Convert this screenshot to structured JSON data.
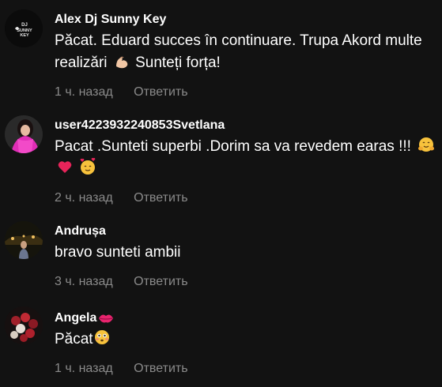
{
  "comments": [
    {
      "author": "Alex Dj Sunny Key",
      "avatar_text": "DJ SUNNY KEY",
      "text_before": "Păcat. Eduard succes în continuare. Trupa Akord multe realizări",
      "text_after": " Sunteți forța!",
      "emojis": [
        "flexed-biceps-emoji"
      ],
      "time": "1 ч. назад",
      "reply_label": "Ответить"
    },
    {
      "author": "user4223932240853Svetlana",
      "text_before": "Pacat .Sunteti superbi .Dorim sa va revedem earas !!!",
      "emojis": [
        "hugging-face-emoji",
        "heart-emoji",
        "smiling-face-hearts-emoji"
      ],
      "time": "2 ч. назад",
      "reply_label": "Ответить"
    },
    {
      "author": "Andrușa",
      "text_before": "bravo sunteti ambii",
      "time": "3 ч. назад",
      "reply_label": "Ответить"
    },
    {
      "author": "Angela",
      "author_emoji": "kiss-mark-emoji",
      "text_before": "Păcat",
      "emojis": [
        "flushed-face-emoji"
      ],
      "time": "1 ч. назад",
      "reply_label": "Ответить"
    }
  ],
  "colors": {
    "background": "#121212",
    "text": "#ffffff",
    "meta": "#8a8a8a"
  }
}
